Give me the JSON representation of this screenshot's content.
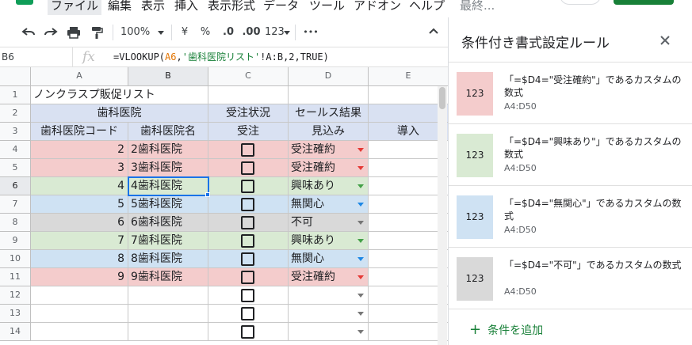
{
  "menu": {
    "items": [
      "ファイル",
      "編集",
      "表示",
      "挿入",
      "表示形式",
      "データ",
      "ツール",
      "アドオン",
      "ヘルプ"
    ],
    "extra": "最終..."
  },
  "toolbar": {
    "zoom": "100%",
    "currency": "¥",
    "percent": "%",
    "dec_less": ".0",
    "dec_more": ".00",
    "format_123": "123",
    "more": "•••"
  },
  "formula_bar": {
    "name_box": "B6",
    "fx": "fx",
    "formula_prefix": "=VLOOKUP(",
    "formula_ref": "A6",
    "formula_comma": ",",
    "formula_string": "'歯科医院リスト'",
    "formula_suffix": "!A:B,2,TRUE)"
  },
  "grid": {
    "columns": [
      "A",
      "B",
      "C",
      "D",
      "E"
    ],
    "selected_column": "B",
    "selected_row": 6,
    "row_numbers": [
      "1",
      "2",
      "3",
      "4",
      "5",
      "6",
      "7",
      "8",
      "9",
      "10",
      "11",
      "12",
      "13",
      "14"
    ],
    "title": "ノンクラスプ販促リスト",
    "group_headers": {
      "clinic": "歯科医院",
      "order_status": "受注状況",
      "sales_result": "セールス結果"
    },
    "sub_headers": {
      "code": "歯科医院コード",
      "name": "歯科医院名",
      "order": "受注",
      "prospect": "見込み",
      "install": "導入"
    },
    "rows": [
      {
        "code": "2",
        "name": "2歯科医院",
        "status": "受注確約",
        "color": "#f4cccc",
        "arrow": "#e53935"
      },
      {
        "code": "3",
        "name": "3歯科医院",
        "status": "受注確約",
        "color": "#f4cccc",
        "arrow": "#e53935"
      },
      {
        "code": "4",
        "name": "4歯科医院",
        "status": "興味あり",
        "color": "#d9ead3",
        "arrow": "#43a047"
      },
      {
        "code": "5",
        "name": "5歯科医院",
        "status": "無関心",
        "color": "#cfe2f3",
        "arrow": "#1e88e5"
      },
      {
        "code": "6",
        "name": "6歯科医院",
        "status": "不可",
        "color": "#d9d9d9",
        "arrow": "#757575"
      },
      {
        "code": "7",
        "name": "7歯科医院",
        "status": "興味あり",
        "color": "#d9ead3",
        "arrow": "#43a047"
      },
      {
        "code": "8",
        "name": "8歯科医院",
        "status": "無関心",
        "color": "#cfe2f3",
        "arrow": "#1e88e5"
      },
      {
        "code": "9",
        "name": "9歯科医院",
        "status": "受注確約",
        "color": "#f4cccc",
        "arrow": "#e53935"
      }
    ]
  },
  "panel": {
    "title": "条件付き書式設定ルール",
    "close_icon": "close-icon",
    "rules": [
      {
        "swatch_label": "123",
        "formula_text": "「=$D4=\"受注確約\"」であるカスタムの数式",
        "range": "A4:D50",
        "color": "#f4cccc"
      },
      {
        "swatch_label": "123",
        "formula_text": "「=$D4=\"興味あり\"」であるカスタムの数式",
        "range": "A4:D50",
        "color": "#d9ead3"
      },
      {
        "swatch_label": "123",
        "formula_text": "「=$D4=\"無関心\"」であるカスタムの数式",
        "range": "A4:D50",
        "color": "#cfe2f3"
      },
      {
        "swatch_label": "123",
        "formula_text": "「=$D4=\"不可\"」であるカスタムの数式",
        "range": "A4:D50",
        "color": "#d9d9d9"
      }
    ],
    "add_label": "条件を追加"
  }
}
